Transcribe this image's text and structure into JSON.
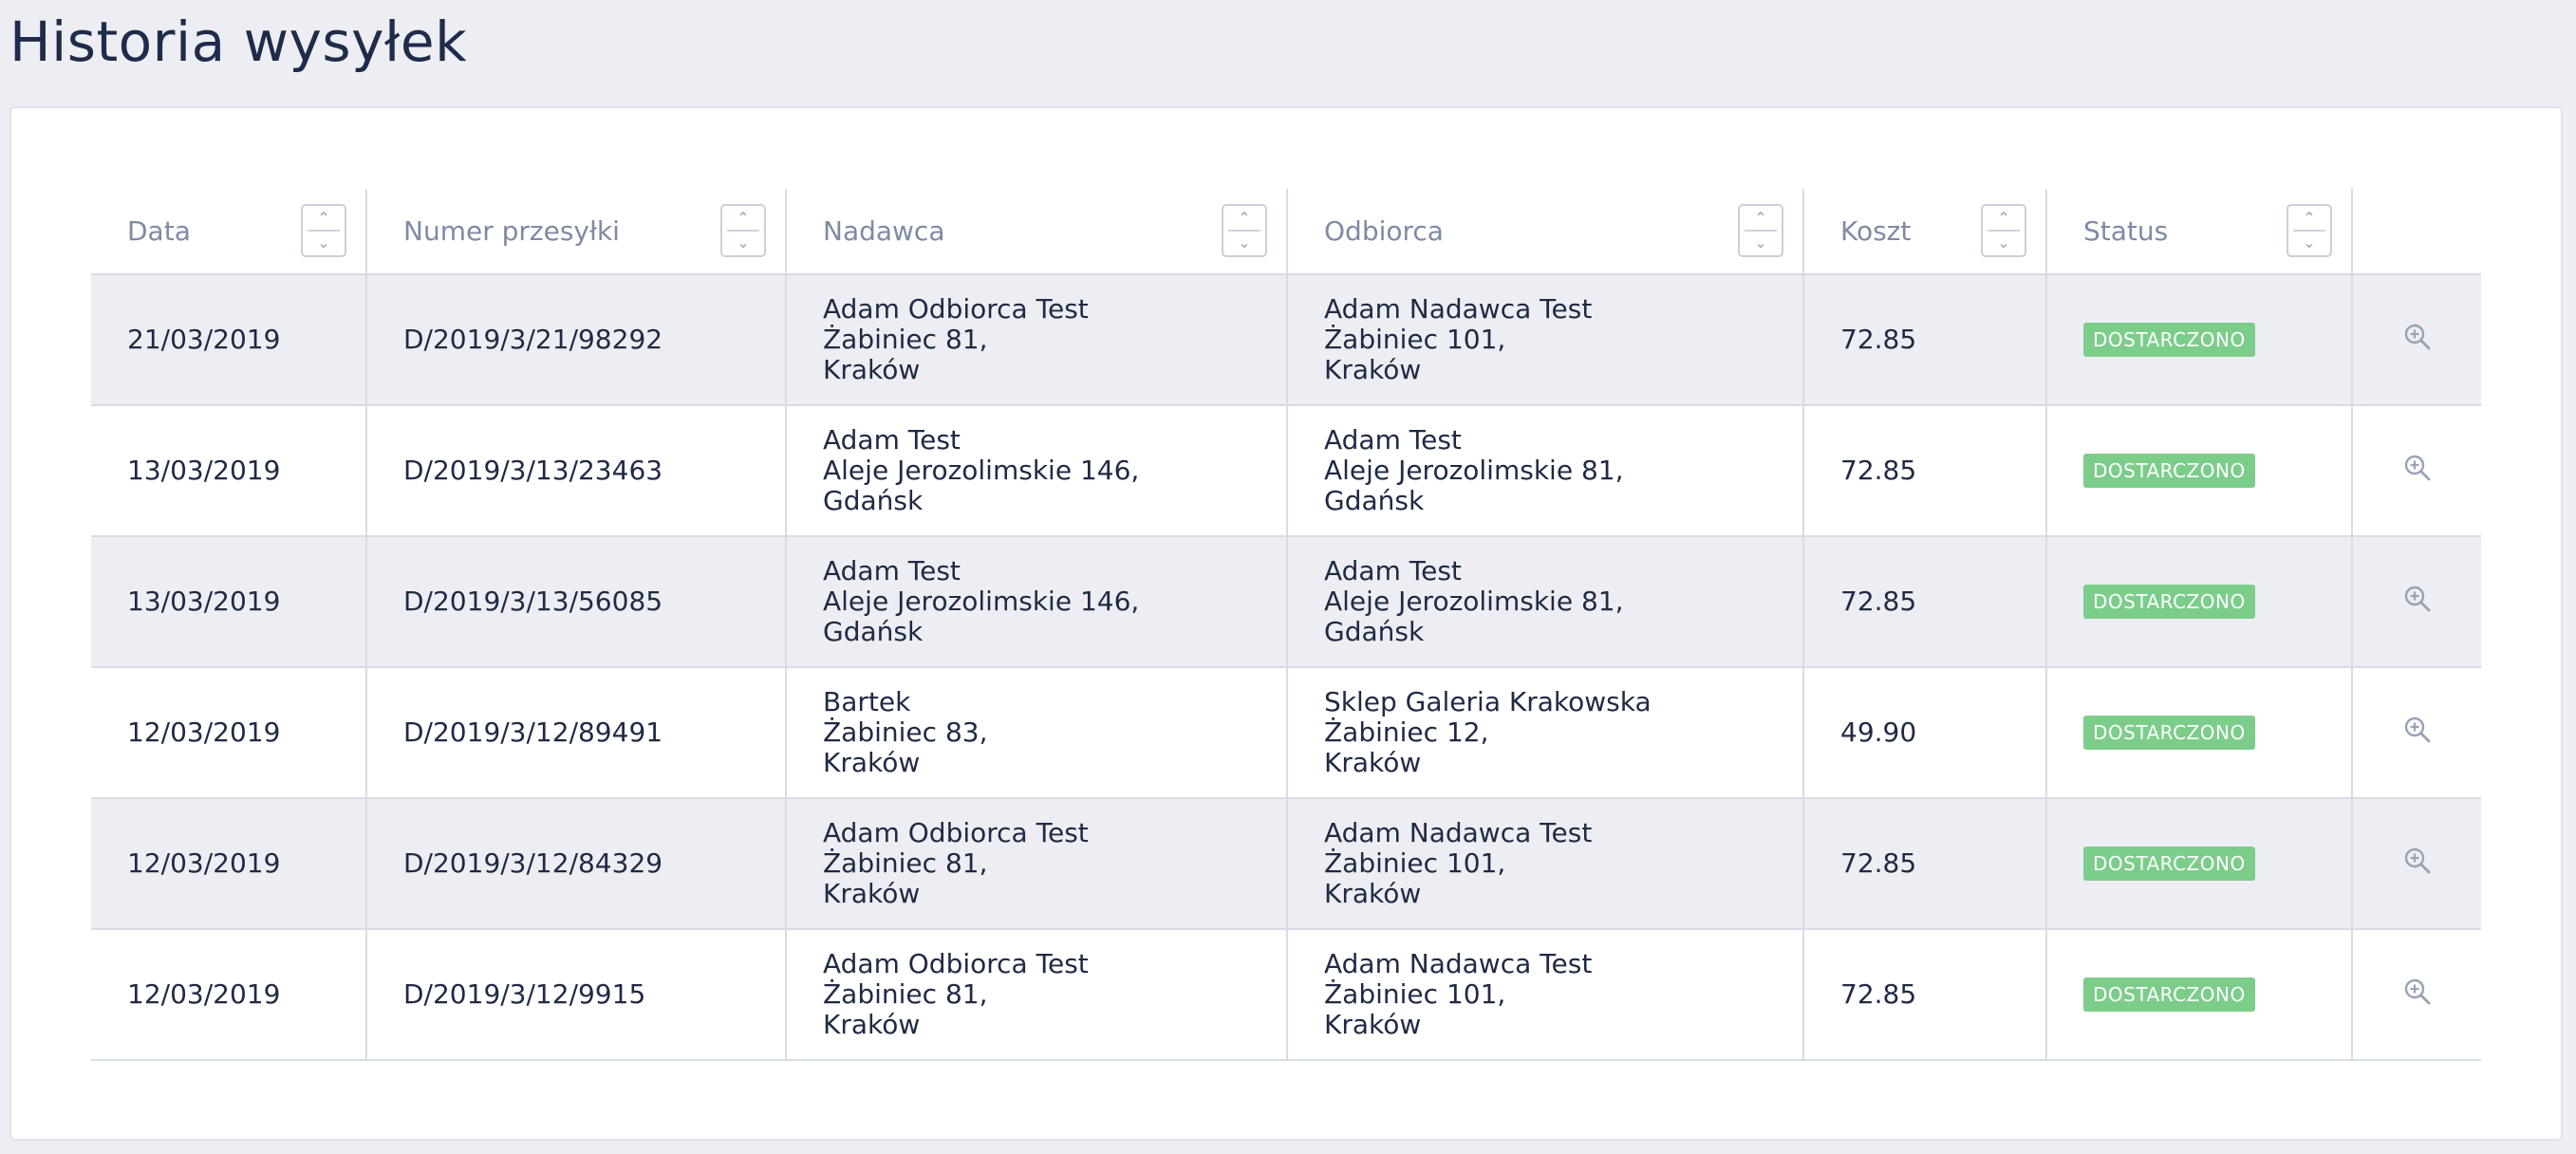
{
  "page": {
    "title": "Historia wysyłek"
  },
  "table": {
    "columns": [
      "Data",
      "Numer przesyłki",
      "Nadawca",
      "Odbiorca",
      "Koszt",
      "Status"
    ],
    "rows": [
      {
        "date": "21/03/2019",
        "number": "D/2019/3/21/98292",
        "sender": [
          "Adam Odbiorca Test",
          "Żabiniec 81,",
          "Kraków"
        ],
        "recipient": [
          "Adam Nadawca Test",
          "Żabiniec 101,",
          "Kraków"
        ],
        "cost": "72.85",
        "status": "DOSTARCZONO"
      },
      {
        "date": "13/03/2019",
        "number": "D/2019/3/13/23463",
        "sender": [
          "Adam Test",
          "Aleje Jerozolimskie 146,",
          "Gdańsk"
        ],
        "recipient": [
          "Adam Test",
          "Aleje Jerozolimskie 81,",
          "Gdańsk"
        ],
        "cost": "72.85",
        "status": "DOSTARCZONO"
      },
      {
        "date": "13/03/2019",
        "number": "D/2019/3/13/56085",
        "sender": [
          "Adam Test",
          "Aleje Jerozolimskie 146,",
          "Gdańsk"
        ],
        "recipient": [
          "Adam Test",
          "Aleje Jerozolimskie 81,",
          "Gdańsk"
        ],
        "cost": "72.85",
        "status": "DOSTARCZONO"
      },
      {
        "date": "12/03/2019",
        "number": "D/2019/3/12/89491",
        "sender": [
          "Bartek",
          "Żabiniec 83,",
          "Kraków"
        ],
        "recipient": [
          "Sklep Galeria Krakowska",
          "Żabiniec 12,",
          "Kraków"
        ],
        "cost": "49.90",
        "status": "DOSTARCZONO"
      },
      {
        "date": "12/03/2019",
        "number": "D/2019/3/12/84329",
        "sender": [
          "Adam Odbiorca Test",
          "Żabiniec 81,",
          "Kraków"
        ],
        "recipient": [
          "Adam Nadawca Test",
          "Żabiniec 101,",
          "Kraków"
        ],
        "cost": "72.85",
        "status": "DOSTARCZONO"
      },
      {
        "date": "12/03/2019",
        "number": "D/2019/3/12/9915",
        "sender": [
          "Adam Odbiorca Test",
          "Żabiniec 81,",
          "Kraków"
        ],
        "recipient": [
          "Adam Nadawca Test",
          "Żabiniec 101,",
          "Kraków"
        ],
        "cost": "72.85",
        "status": "DOSTARCZONO"
      }
    ]
  },
  "icons": {
    "sort": "sort-updown-icon",
    "view": "zoom-in-icon"
  },
  "colors": {
    "status_delivered": "#7ccd8a",
    "row_stripe": "#eceef3",
    "title": "#1e2b4a"
  }
}
